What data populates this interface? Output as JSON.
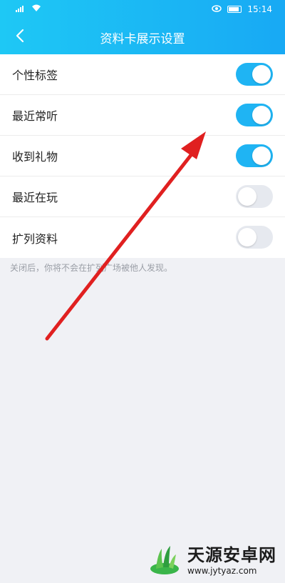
{
  "status_bar": {
    "signal": "4G",
    "time": "15:14"
  },
  "header": {
    "title": "资料卡展示设置",
    "back_icon": "chevron-left-icon"
  },
  "settings": {
    "items": [
      {
        "label": "个性标签",
        "enabled": true
      },
      {
        "label": "最近常听",
        "enabled": true
      },
      {
        "label": "收到礼物",
        "enabled": true
      },
      {
        "label": "最近在玩",
        "enabled": false
      },
      {
        "label": "扩列资料",
        "enabled": false
      }
    ],
    "hint": "关闭后，你将不会在扩列广场被他人发现。"
  },
  "annotation": {
    "type": "arrow",
    "color": "#e02020"
  },
  "watermark": {
    "title": "天源安卓网",
    "url": "www.jytyaz.com"
  },
  "colors": {
    "accent": "#1fb4f3",
    "switch_off": "#e6e9ef",
    "background": "#f0f1f5"
  }
}
